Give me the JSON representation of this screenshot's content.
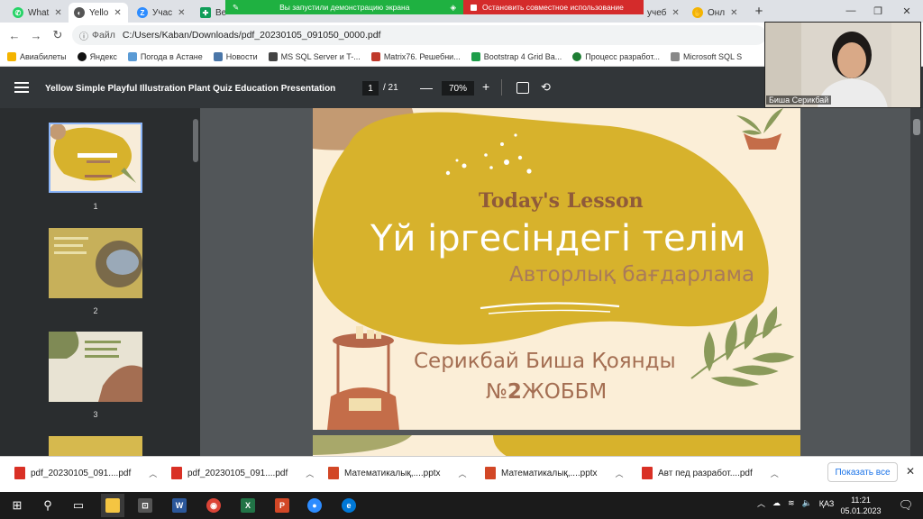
{
  "tabs": [
    {
      "label": "What",
      "color": "#25d366",
      "glyph": "✆",
      "icon": "whatsapp-icon"
    },
    {
      "label": "Yello",
      "color": "#555555",
      "glyph": "◐",
      "icon": "chrome-pdf-icon"
    },
    {
      "label": "Учас",
      "color": "#2d8cff",
      "glyph": "Z",
      "icon": "zoom-icon"
    },
    {
      "label": "Веб",
      "color": "#0f9d58",
      "glyph": "✚",
      "icon": "sheets-icon"
    },
    {
      "label": "учеб",
      "color": "#4285f4",
      "glyph": "",
      "icon": "tab-icon"
    },
    {
      "label": "Онл",
      "color": "#f4b400",
      "glyph": "✋",
      "icon": "hand-icon"
    }
  ],
  "share_banner": {
    "started": "Вы запустили демонстрацию экрана",
    "stop": "Остановить совместное использование"
  },
  "address_bar": {
    "scheme": "Файл",
    "url": "C:/Users/Kaban/Downloads/pdf_20230105_091050_0000.pdf"
  },
  "bookmarks": [
    {
      "label": "Авиабилеты",
      "color": "#f4b400"
    },
    {
      "label": "Яндекс",
      "color": "#111111"
    },
    {
      "label": "Погода в Астане",
      "color": "#5b9bd5"
    },
    {
      "label": "Новости",
      "color": "#4a76a8"
    },
    {
      "label": "MS SQL Server и T-...",
      "color": "#444444"
    },
    {
      "label": "Matrix76. Решебни...",
      "color": "#c0392b"
    },
    {
      "label": "Bootstrap 4 Grid Ba...",
      "color": "#1e9e4a"
    },
    {
      "label": "Процесс разработ...",
      "color": "#1e7e34"
    },
    {
      "label": "Microsoft SQL S",
      "color": "#888888"
    }
  ],
  "pdf_toolbar": {
    "title": "Yellow Simple Playful Illustration Plant Quiz Education Presentation",
    "current_page": "1",
    "total_pages": "/ 21",
    "zoom": "70%"
  },
  "thumbnails": [
    {
      "num": "1"
    },
    {
      "num": "2"
    },
    {
      "num": "3"
    }
  ],
  "slide": {
    "lesson": "Today's Lesson",
    "title": "Үй іргесіндегі телім",
    "subtitle": "Авторлық бағдарлама",
    "author": "Серикбай Биша Қоянды",
    "school_prefix": "№",
    "school_num": "2",
    "school_suffix": "ЖОББМ"
  },
  "webcam": {
    "name": "Биша Серикбай"
  },
  "downloads": [
    {
      "name": "pdf_20230105_091....pdf",
      "color": "#d93025"
    },
    {
      "name": "pdf_20230105_091....pdf",
      "color": "#d93025"
    },
    {
      "name": "Математикалық,....pptx",
      "color": "#d24726"
    },
    {
      "name": "Математикалық,....pptx",
      "color": "#d24726"
    },
    {
      "name": "Авт пед разработ....pdf",
      "color": "#d93025"
    }
  ],
  "show_all": "Показать все",
  "tray": {
    "lang": "ҚАЗ"
  },
  "clock": {
    "time": "11:21",
    "date": "05.01.2023"
  }
}
